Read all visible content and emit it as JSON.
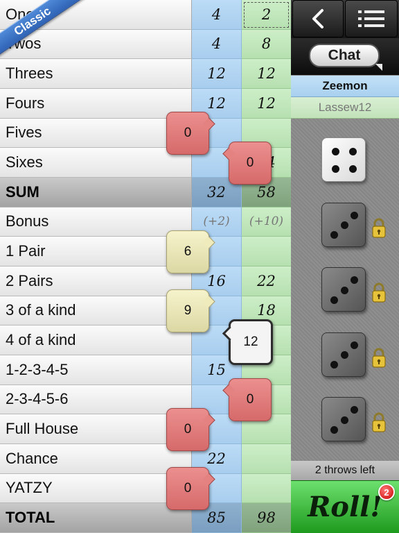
{
  "game": {
    "mode_badge": "Classic"
  },
  "rows": [
    {
      "label": "Ones",
      "p1": "4",
      "p2": "2",
      "type": "normal"
    },
    {
      "label": "Twos",
      "p1": "4",
      "p2": "8",
      "type": "normal"
    },
    {
      "label": "Threes",
      "p1": "12",
      "p2": "12",
      "type": "normal"
    },
    {
      "label": "Fours",
      "p1": "12",
      "p2": "12",
      "type": "normal"
    },
    {
      "label": "Fives",
      "p1": "",
      "p2": "",
      "type": "normal"
    },
    {
      "label": "Sixes",
      "p1": "",
      "p2": "24",
      "type": "normal"
    },
    {
      "label": "SUM",
      "p1": "32",
      "p2": "58",
      "type": "sum"
    },
    {
      "label": "Bonus",
      "p1": "(+2)",
      "p2": "(+10)",
      "type": "bonus"
    },
    {
      "label": "1 Pair",
      "p1": "",
      "p2": "",
      "type": "normal"
    },
    {
      "label": "2 Pairs",
      "p1": "16",
      "p2": "22",
      "type": "normal"
    },
    {
      "label": "3 of a kind",
      "p1": "",
      "p2": "18",
      "type": "normal"
    },
    {
      "label": "4 of a kind",
      "p1": "",
      "p2": "",
      "type": "normal"
    },
    {
      "label": "1-2-3-4-5",
      "p1": "15",
      "p2": "",
      "type": "normal"
    },
    {
      "label": "2-3-4-5-6",
      "p1": "",
      "p2": "",
      "type": "normal"
    },
    {
      "label": "Full House",
      "p1": "",
      "p2": "",
      "type": "normal"
    },
    {
      "label": "Chance",
      "p1": "22",
      "p2": "",
      "type": "normal"
    },
    {
      "label": "YATZY",
      "p1": "",
      "p2": "",
      "type": "normal"
    },
    {
      "label": "TOTAL",
      "p1": "85",
      "p2": "98",
      "type": "total"
    }
  ],
  "suggestions": [
    {
      "row": "Fives",
      "value": "0",
      "style": "red"
    },
    {
      "row": "Sixes",
      "value": "0",
      "style": "red"
    },
    {
      "row": "1 Pair",
      "value": "6",
      "style": "yellow"
    },
    {
      "row": "3 of a kind",
      "value": "9",
      "style": "yellow"
    },
    {
      "row": "4 of a kind",
      "value": "12",
      "style": "white"
    },
    {
      "row": "2-3-4-5-6",
      "value": "0",
      "style": "red"
    },
    {
      "row": "Full House",
      "value": "0",
      "style": "red"
    },
    {
      "row": "YATZY",
      "value": "0",
      "style": "red"
    }
  ],
  "panel": {
    "back_icon": "chevron-left-icon",
    "menu_icon": "list-menu-icon",
    "chat_label": "Chat",
    "player1": "Zeemon",
    "player2": "Lassew12",
    "throws_left": "2 throws left",
    "roll_label": "Roll!",
    "roll_badge": "2"
  },
  "dice": [
    {
      "value": 4,
      "held": false,
      "color": "#ffffff"
    },
    {
      "value": 3,
      "held": true,
      "color": "#6e6e6e"
    },
    {
      "value": 3,
      "held": true,
      "color": "#6e6e6e"
    },
    {
      "value": 3,
      "held": true,
      "color": "#6e6e6e"
    },
    {
      "value": 3,
      "held": true,
      "color": "#6e6e6e"
    }
  ],
  "colors": {
    "player1_column": "#b2d4f1",
    "player2_column": "#c1e6bb",
    "roll_button": "#3cc03c",
    "badge": "#d40000"
  }
}
